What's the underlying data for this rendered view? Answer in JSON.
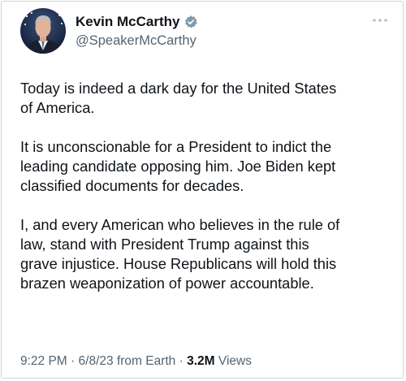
{
  "author": {
    "display_name": "Kevin McCarthy",
    "handle": "@SpeakerMcCarthy",
    "verified": true,
    "avatar_icon": "profile-photo",
    "verified_icon": "verified-badge-icon",
    "verified_color": "#829aab"
  },
  "tweet": {
    "paragraphs": [
      "Today is indeed a dark day for the United States\nof America.",
      "It is unconscionable for a President to indict the\nleading candidate opposing him. Joe Biden kept\nclassified documents for decades.",
      "I, and every American who believes in the rule of\nlaw, stand with President Trump against this\ngrave injustice. House Republicans will hold this\nbrazen weaponization of power accountable."
    ]
  },
  "meta": {
    "time": "9:22 PM",
    "separator": "·",
    "date": "6/8/23",
    "source": "from Earth",
    "views_count": "3.2M",
    "views_label": "Views"
  },
  "icons": {
    "more": "more-options-icon"
  },
  "colors": {
    "text_primary": "#0f1419",
    "text_secondary": "#536471",
    "border": "#cfd4d9"
  }
}
